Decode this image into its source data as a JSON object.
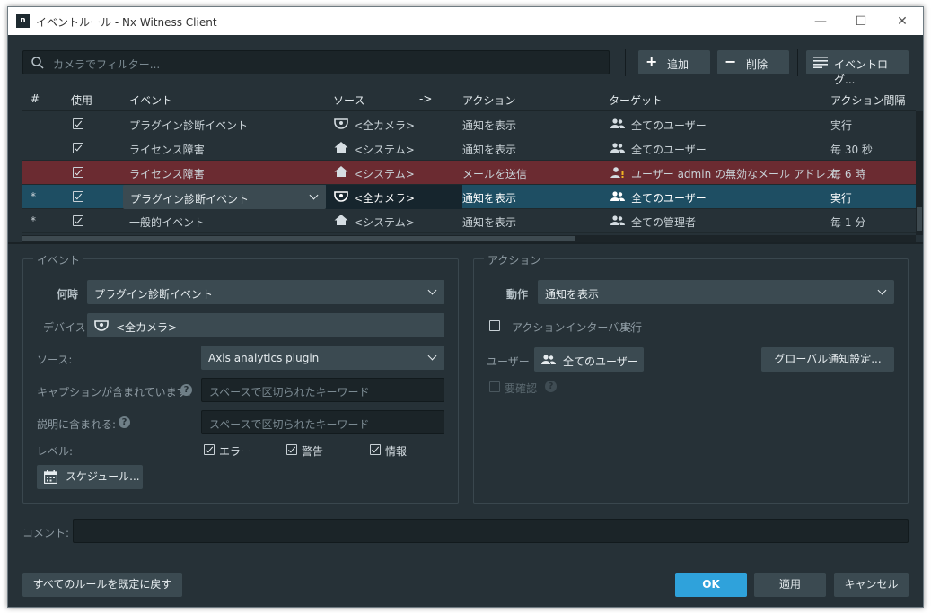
{
  "window": {
    "logo": "n",
    "title": "イベントルール - Nx Witness Client"
  },
  "toolbar": {
    "search_placeholder": "カメラでフィルター...",
    "add_label": "追加",
    "delete_label": "削除",
    "log_label": "イベントログ..."
  },
  "table": {
    "headers": {
      "num": "#",
      "use": "使用",
      "event": "イベント",
      "source": "ソース",
      "arrow": "->",
      "action": "アクション",
      "target": "ターゲット",
      "interval": "アクション間隔"
    },
    "rows": [
      {
        "num": "",
        "enabled": true,
        "event": "プラグイン診断イベント",
        "source": "<全カメラ>",
        "source_icon": "camera-icon",
        "action": "通知を表示",
        "target": "全てのユーザー",
        "target_icon": "users-icon",
        "interval": "実行",
        "state": "normal"
      },
      {
        "num": "",
        "enabled": true,
        "event": "ライセンス障害",
        "source": "<システム>",
        "source_icon": "system-home-icon",
        "action": "通知を表示",
        "target": "全てのユーザー",
        "target_icon": "users-icon",
        "interval": "毎 30 秒",
        "state": "normal"
      },
      {
        "num": "",
        "enabled": true,
        "event": "ライセンス障害",
        "source": "<システム>",
        "source_icon": "system-home-icon",
        "action": "メールを送信",
        "target": "ユーザー admin の無効なメール アドレス",
        "target_icon": "user-warning-icon",
        "interval": "毎 6 時",
        "state": "error"
      },
      {
        "num": "*",
        "enabled": true,
        "event": "プラグイン診断イベント",
        "source": "<全カメラ>",
        "source_icon": "camera-icon",
        "action": "通知を表示",
        "target": "全てのユーザー",
        "target_icon": "users-icon",
        "interval": "実行",
        "state": "selected"
      },
      {
        "num": "*",
        "enabled": true,
        "event": "一般的イベント",
        "source": "<システム>",
        "source_icon": "system-home-icon",
        "action": "通知を表示",
        "target": "全ての管理者",
        "target_icon": "users-icon",
        "interval": "毎 1 分",
        "state": "normal"
      }
    ]
  },
  "event_panel": {
    "group_title": "イベント",
    "when_label": "何時",
    "when_value": "プラグイン診断イベント",
    "device_label": "デバイス",
    "device_value": "<全カメラ>",
    "source_label": "ソース:",
    "source_value": "Axis analytics plugin",
    "caption_label": "キャプションが含まれています:",
    "caption_placeholder": "スペースで区切られたキーワード",
    "description_label": "説明に含まれる:",
    "description_placeholder": "スペースで区切られたキーワード",
    "level_label": "レベル:",
    "levels": [
      {
        "label": "エラー",
        "checked": true
      },
      {
        "label": "警告",
        "checked": true
      },
      {
        "label": "情報",
        "checked": true
      }
    ],
    "schedule_label": "スケジュール..."
  },
  "action_panel": {
    "group_title": "アクション",
    "action_label": "動作",
    "action_value": "通知を表示",
    "interval_label": "アクションインターバル:",
    "interval_value": "実行",
    "interval_checked": false,
    "user_label": "ユーザー",
    "user_value": "全てのユーザー",
    "global_notif_label": "グローバル通知設定...",
    "confirm_label": "要確認",
    "confirm_checked": false
  },
  "comment": {
    "label": "コメント:",
    "value": ""
  },
  "footer": {
    "reset_label": "すべてのルールを既定に戻す",
    "ok_label": "OK",
    "apply_label": "適用",
    "cancel_label": "キャンセル"
  },
  "colors": {
    "accent": "#2fa2db",
    "selected_row": "#1e4e63",
    "error_row": "#6b2b31",
    "background": "#263137"
  }
}
